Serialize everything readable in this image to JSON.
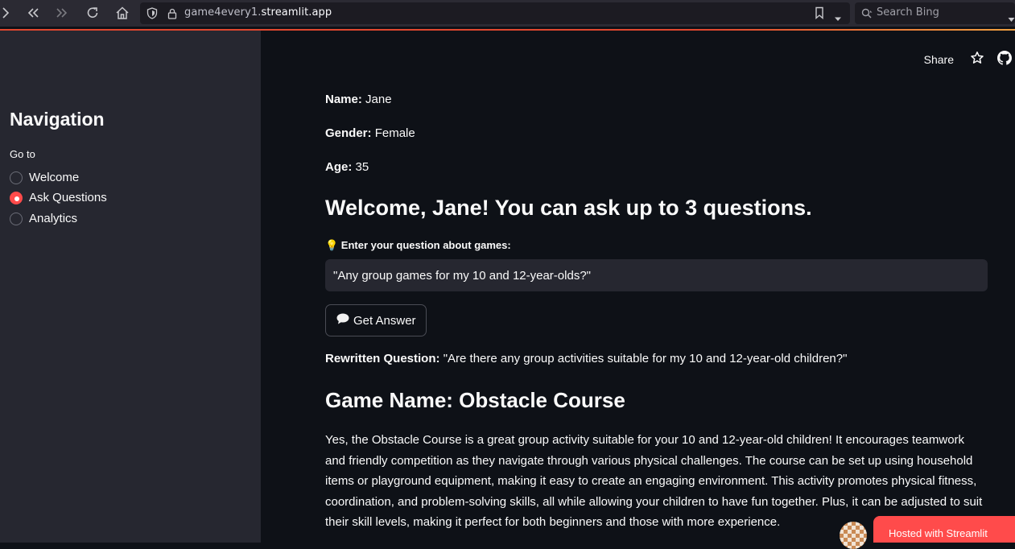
{
  "browser": {
    "url_prefix": "game4every1.",
    "url_host": "streamlit.app",
    "search_placeholder": "Search Bing"
  },
  "sidebar": {
    "title": "Navigation",
    "radio_label": "Go to",
    "options": [
      {
        "label": "Welcome",
        "selected": false
      },
      {
        "label": "Ask Questions",
        "selected": true
      },
      {
        "label": "Analytics",
        "selected": false
      }
    ]
  },
  "header": {
    "share_label": "Share"
  },
  "main": {
    "name_label": "Name:",
    "name_value": "Jane",
    "gender_label": "Gender:",
    "gender_value": "Female",
    "age_label": "Age:",
    "age_value": "35",
    "welcome_heading": "Welcome, Jane! You can ask up to 3 questions.",
    "question_label": "💡 Enter your question about games:",
    "question_value": "\"Any group games for my 10 and 12-year-olds?\"",
    "button_label": "Get Answer",
    "rewritten_label": "Rewritten Question:",
    "rewritten_value": "\"Are there any group activities suitable for my 10 and 12-year-old children?\"",
    "game_heading": "Game Name: Obstacle Course",
    "description": "Yes, the Obstacle Course is a great group activity suitable for your 10 and 12-year-old children! It encourages teamwork and friendly competition as they navigate through various physical challenges. The course can be set up using household items or playground equipment, making it easy to create an engaging environment. This activity promotes physical fitness, coordination, and problem-solving skills, all while allowing your children to have fun together. Plus, it can be adjusted to suit their skill levels, making it perfect for both beginners and those with more experience."
  },
  "footer": {
    "hosted_label": "Hosted with Streamlit"
  },
  "colors": {
    "accent": "#ff4b4b",
    "sidebar_bg": "#262730",
    "main_bg": "#0e1117"
  }
}
